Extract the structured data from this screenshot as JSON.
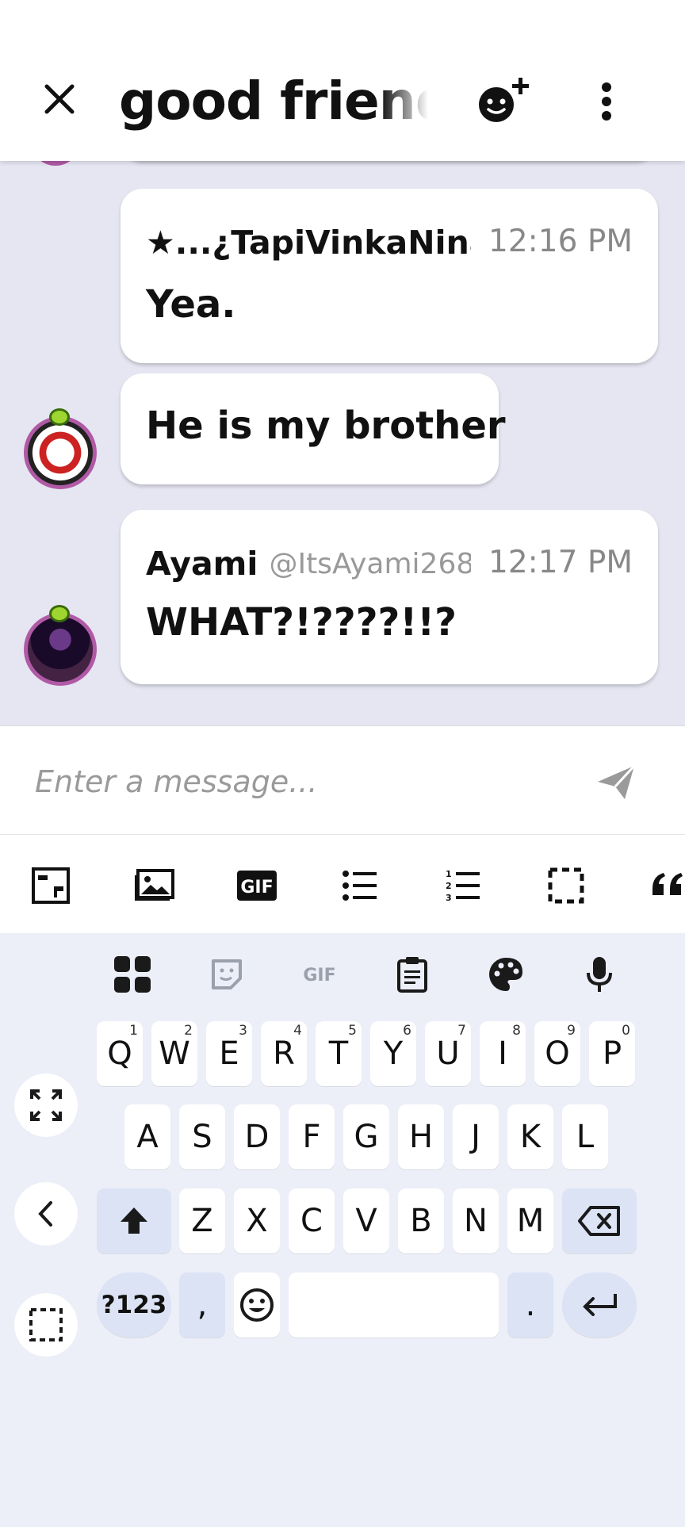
{
  "header": {
    "close_icon": "close-icon",
    "title": "good friends",
    "add_member_icon": "add-member-icon",
    "more_icon": "more-vert-icon"
  },
  "messages": [
    {
      "sender": "★...¿TapiVinkaNina",
      "time": "12:16 PM",
      "text": "Yea."
    },
    {
      "text": "He is my brother"
    },
    {
      "sender": "Ayami",
      "handle": "@ItsAyami268",
      "time": "12:17 PM",
      "text": "WHAT?!????!!?"
    }
  ],
  "composer": {
    "placeholder": "Enter a message...",
    "send_icon": "send-icon"
  },
  "format_toolbar": {
    "gif_label": "GIF",
    "items": [
      "screenshot-icon",
      "image-icon",
      "gif-icon",
      "bullet-list-icon",
      "numbered-list-icon",
      "selection-icon",
      "quote-icon"
    ]
  },
  "keyboard": {
    "toolbar": {
      "gif_label": "GIF",
      "items": [
        "apps-grid-icon",
        "sticker-icon",
        "gif-icon",
        "clipboard-icon",
        "palette-icon",
        "microphone-icon"
      ]
    },
    "row1": [
      {
        "key": "Q",
        "hint": "1"
      },
      {
        "key": "W",
        "hint": "2"
      },
      {
        "key": "E",
        "hint": "3"
      },
      {
        "key": "R",
        "hint": "4"
      },
      {
        "key": "T",
        "hint": "5"
      },
      {
        "key": "Y",
        "hint": "6"
      },
      {
        "key": "U",
        "hint": "7"
      },
      {
        "key": "I",
        "hint": "8"
      },
      {
        "key": "O",
        "hint": "9"
      },
      {
        "key": "P",
        "hint": "0"
      }
    ],
    "row2": [
      "A",
      "S",
      "D",
      "F",
      "G",
      "H",
      "J",
      "K",
      "L"
    ],
    "row3": [
      "Z",
      "X",
      "C",
      "V",
      "B",
      "N",
      "M"
    ],
    "bottom": {
      "symbols": "?123",
      "comma": ",",
      "period": ".",
      "space": ""
    },
    "colors": {
      "accent_bg": "#dbe3f5",
      "keyboard_bg": "#eceef8"
    }
  }
}
